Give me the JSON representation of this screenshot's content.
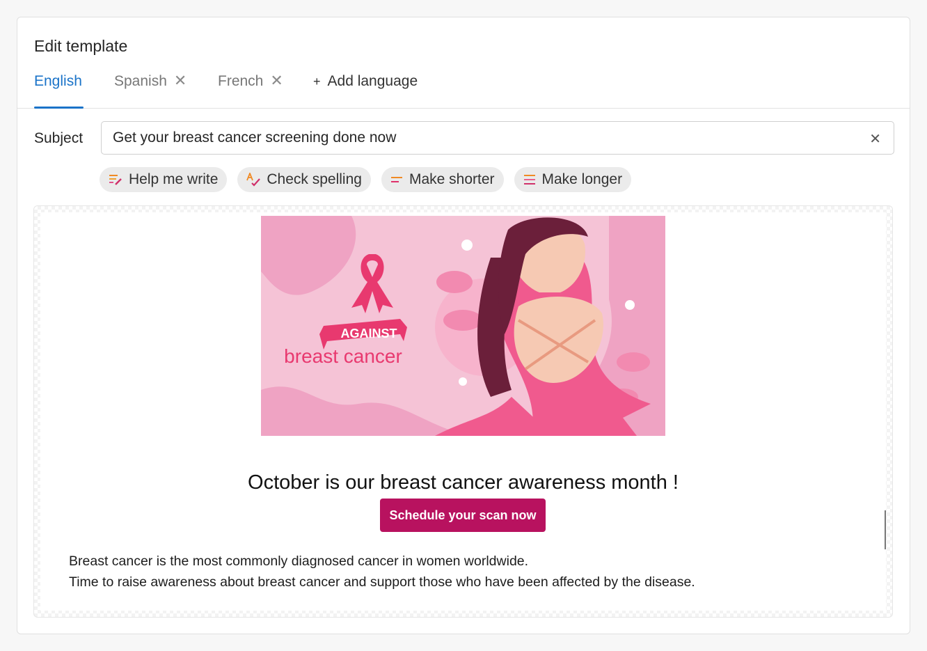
{
  "window": {
    "title": "Edit template"
  },
  "tabs": [
    {
      "label": "English",
      "active": true,
      "closable": false
    },
    {
      "label": "Spanish",
      "active": false,
      "closable": true
    },
    {
      "label": "French",
      "active": false,
      "closable": true
    }
  ],
  "add_language": {
    "label": "Add language",
    "icon": "plus-icon"
  },
  "subject": {
    "label": "Subject",
    "value": "Get your breast cancer screening done now",
    "clear_icon": "close-icon"
  },
  "ai_actions": [
    {
      "label": "Help me write",
      "icon": "pen-lines-icon"
    },
    {
      "label": "Check spelling",
      "icon": "spellcheck-icon"
    },
    {
      "label": "Make shorter",
      "icon": "short-lines-icon"
    },
    {
      "label": "Make longer",
      "icon": "long-lines-icon"
    }
  ],
  "email": {
    "banner": {
      "ribbon_text": "AGAINST",
      "caption": "breast cancer"
    },
    "headline": "October is our breast cancer awareness month !",
    "cta_label": "Schedule your scan now",
    "body_lines": [
      "Breast cancer is the most commonly diagnosed cancer in women worldwide.",
      "Time to raise awareness about breast cancer and support those who have been affected by the disease."
    ]
  },
  "colors": {
    "accent": "#1a73c8",
    "cta": "#b8125f",
    "banner_bg": "#f5c3d6",
    "ribbon": "#f05a8e"
  }
}
